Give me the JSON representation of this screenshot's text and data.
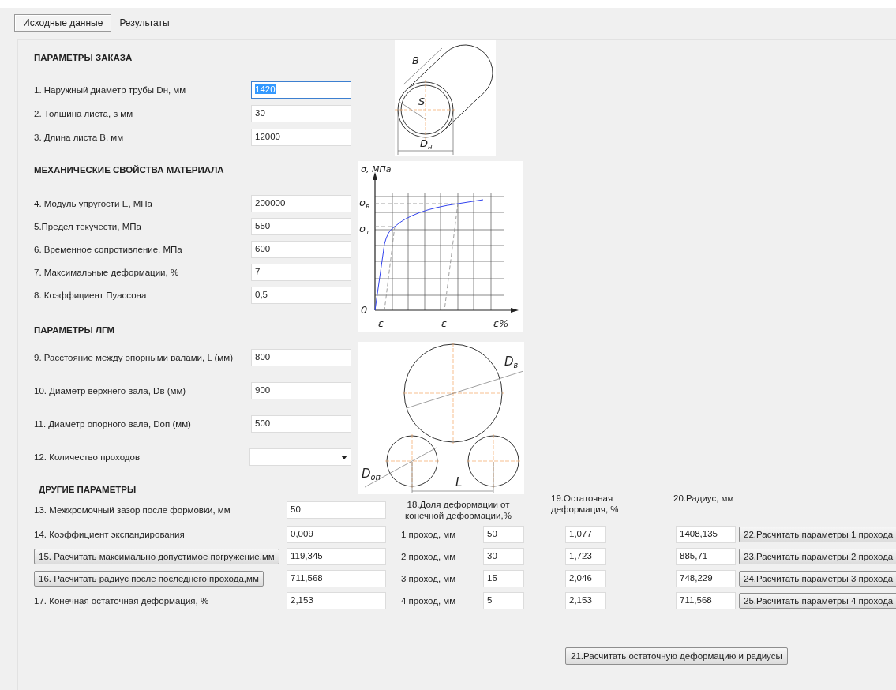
{
  "tabs": [
    {
      "label": "Исходные данные",
      "selected": true
    },
    {
      "label": "Результаты",
      "selected": false
    }
  ],
  "order_params": {
    "title": "ПАРАМЕТРЫ ЗАКАЗА",
    "fields": [
      {
        "label": "1. Наружный диаметр трубы  Dн, мм",
        "value": "1420",
        "focused": true
      },
      {
        "label": "2. Толщина листа, s мм",
        "value": "30",
        "focused": false
      },
      {
        "label": "3. Длина листа В, мм",
        "value": "12000",
        "focused": false
      }
    ]
  },
  "material": {
    "title": "МЕХАНИЧЕСКИЕ СВОЙСТВА МАТЕРИАЛА",
    "fields": [
      {
        "label": "4. Модуль упругости Е, МПа",
        "value": "200000",
        "focused": false
      },
      {
        "label": "5.Предел   текучести,   МПа",
        "value": "550",
        "focused": false
      },
      {
        "label": "6. Временное сопротивление, МПа",
        "value": "600",
        "focused": false
      },
      {
        "label": "7. Максимальные деформации, %",
        "value": "7",
        "focused": false
      },
      {
        "label": "8. Коэффициент Пуассона",
        "value": "0,5",
        "focused": false
      }
    ]
  },
  "mill": {
    "title": "ПАРАМЕТРЫ ЛГМ",
    "fields": [
      {
        "label": "9. Расстояние между опорными валами, L (мм)",
        "value": "800",
        "focused": false
      },
      {
        "label": "10.  Диаметр верхнего вала, Dв (мм)",
        "value": "900",
        "focused": false
      },
      {
        "label": "11.  Диаметр опорного вала, Dоп (мм)",
        "value": "500",
        "focused": false
      }
    ],
    "passes_dropdown": {
      "label": "12. Количество проходов"
    }
  },
  "pipe_drawing": {
    "labels": [
      {
        "text": "B"
      },
      {
        "text": "S"
      },
      {
        "text": "D",
        "sub": "н"
      }
    ]
  },
  "stress_strain_drawing": {
    "labels": [
      {
        "text": "σ, МПа"
      },
      {
        "text": "σ",
        "sub": "в"
      },
      {
        "text": "σ",
        "sub": "т"
      },
      {
        "text": "0"
      },
      {
        "text": "ε"
      },
      {
        "text": "ε"
      },
      {
        "text": "ε%"
      }
    ]
  },
  "rolls_drawing": {
    "labels": [
      {
        "text": "D",
        "sub": "в"
      },
      {
        "text": "D",
        "sub": "оп"
      },
      {
        "text": "L"
      }
    ]
  },
  "other_params": {
    "title": "ДРУГИЕ ПАРАМЕТРЫ",
    "rows": [
      {
        "kind": "label",
        "label": "13. Межкромочный зазор после формовки, мм",
        "value": "50"
      },
      {
        "kind": "label",
        "label": "14. Коэффициент экспандирования",
        "value": "0,009"
      },
      {
        "kind": "button",
        "label": "15. Расчитать максимально допустимое погружение,мм",
        "value": "119,345"
      },
      {
        "kind": "button",
        "label": "16. Расчитать радиус после последнего прохода,мм",
        "value": "711,568"
      },
      {
        "kind": "label",
        "label": "17. Конечная остаточная деформация, %",
        "value": "2,153"
      }
    ]
  },
  "passes": {
    "share_header": "18.Доля деформации  от конечной деформации,%",
    "residual_header": "19.Остаточная деформация, %",
    "radius_header": "20.Радиус, мм",
    "rows": [
      {
        "label": "1 проход, мм",
        "share": "50",
        "residual": "1,077",
        "radius": "1408,135",
        "button": "22.Расчитать параметры 1 прохода"
      },
      {
        "label": "2 проход, мм",
        "share": "30",
        "residual": "1,723",
        "radius": "885,71",
        "button": "23.Расчитать параметры 2 прохода"
      },
      {
        "label": "3 проход, мм",
        "share": "15",
        "residual": "2,046",
        "radius": "748,229",
        "button": "24.Расчитать параметры 3 прохода"
      },
      {
        "label": "4 проход, мм",
        "share": "5",
        "residual": "2,153",
        "radius": "711,568",
        "button": "25.Расчитать параметры 4 прохода"
      }
    ]
  },
  "total_button": "21.Расчитать остаточную деформацию и радиусы"
}
